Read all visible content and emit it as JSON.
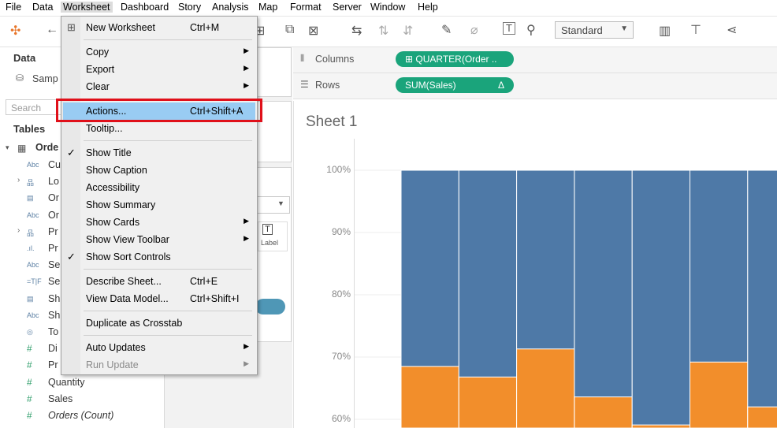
{
  "menubar": [
    "File",
    "Data",
    "Worksheet",
    "Dashboard",
    "Story",
    "Analysis",
    "Map",
    "Format",
    "Server",
    "Window",
    "Help"
  ],
  "toolbar": {
    "view_mode": "Standard"
  },
  "left_pane": {
    "data_title": "Data",
    "datasource": "Samp",
    "search_placeholder": "Search",
    "tables_title": "Tables",
    "table_name": "Orde",
    "fields": [
      {
        "type": "Abc",
        "name": "Cu"
      },
      {
        "type": "geo",
        "name": "Lo"
      },
      {
        "type": "date",
        "name": "Or"
      },
      {
        "type": "Abc",
        "name": "Or"
      },
      {
        "type": "geo",
        "name": "Pr"
      },
      {
        "type": "bin",
        "name": "Pr"
      },
      {
        "type": "Abc",
        "name": "Se"
      },
      {
        "type": "=T|F",
        "name": "Se"
      },
      {
        "type": "date",
        "name": "Sh"
      },
      {
        "type": "Abc",
        "name": "Sh"
      },
      {
        "type": "geo2",
        "name": "To"
      },
      {
        "type": "#",
        "name": "Di"
      },
      {
        "type": "#",
        "name": "Pr"
      },
      {
        "type": "#",
        "name": "Quantity"
      },
      {
        "type": "#",
        "name": "Sales"
      },
      {
        "type": "#",
        "name": "Orders (Count)"
      }
    ]
  },
  "marks": {
    "label_button": "Label"
  },
  "shelves": {
    "columns_label": "Columns",
    "columns_pill": "QUARTER(Order ..",
    "rows_label": "Rows",
    "rows_pill": "SUM(Sales)",
    "rows_pill_icon": "Δ"
  },
  "sheet": {
    "title": "Sheet 1"
  },
  "chart_data": {
    "type": "bar",
    "stacked": true,
    "percent_scale": true,
    "y_ticks": [
      "100%",
      "90%",
      "80%",
      "70%",
      "60%"
    ],
    "ylim": [
      0.6,
      1.0
    ],
    "series": [
      {
        "color": "#4e79a7",
        "values": [
          1,
          1,
          1,
          1,
          1,
          1,
          1
        ]
      },
      {
        "color": "#f28e2b",
        "values": [
          0.685,
          0.668,
          0.713,
          0.636,
          0.591,
          0.692,
          0.62
        ]
      }
    ],
    "visible_range_bottom": 0.586
  },
  "worksheet_menu": {
    "items": [
      {
        "label": "New Worksheet",
        "shortcut": "Ctrl+M",
        "icon": "new-worksheet-icon"
      },
      {
        "sep": true
      },
      {
        "label": "Copy",
        "submenu": true
      },
      {
        "label": "Export",
        "submenu": true
      },
      {
        "label": "Clear",
        "submenu": true
      },
      {
        "sep": true
      },
      {
        "label": "Actions...",
        "shortcut": "Ctrl+Shift+A",
        "highlighted": true
      },
      {
        "label": "Tooltip..."
      },
      {
        "sep": true
      },
      {
        "label": "Show Title",
        "checked": true
      },
      {
        "label": "Show Caption"
      },
      {
        "label": "Accessibility"
      },
      {
        "label": "Show Summary"
      },
      {
        "label": "Show Cards",
        "submenu": true
      },
      {
        "label": "Show View Toolbar",
        "submenu": true
      },
      {
        "label": "Show Sort Controls",
        "checked": true
      },
      {
        "sep": true
      },
      {
        "label": "Describe Sheet...",
        "shortcut": "Ctrl+E"
      },
      {
        "label": "View Data Model...",
        "shortcut": "Ctrl+Shift+I"
      },
      {
        "sep": true
      },
      {
        "label": "Duplicate as Crosstab"
      },
      {
        "sep": true
      },
      {
        "label": "Auto Updates",
        "submenu": true
      },
      {
        "label": "Run Update",
        "submenu": true,
        "disabled": true
      }
    ]
  }
}
